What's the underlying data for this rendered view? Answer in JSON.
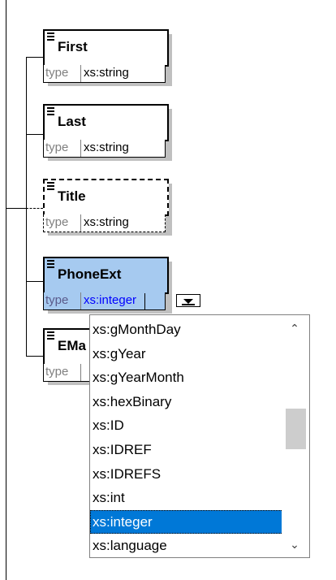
{
  "colors": {
    "selection_fill": "#a6caf0",
    "list_highlight": "#0078d7",
    "type_value_selected": "#0000ff",
    "shadow": "#c0c0c0"
  },
  "elements": [
    {
      "name": "First",
      "type_label": "type",
      "type_value": "xs:string",
      "optional": false,
      "selected": false
    },
    {
      "name": "Last",
      "type_label": "type",
      "type_value": "xs:string",
      "optional": false,
      "selected": false
    },
    {
      "name": "Title",
      "type_label": "type",
      "type_value": "xs:string",
      "optional": true,
      "selected": false
    },
    {
      "name": "PhoneExt",
      "type_label": "type",
      "type_value": "xs:integer",
      "optional": false,
      "selected": true
    },
    {
      "name": "EMa",
      "type_label": "type",
      "type_value": "",
      "optional": false,
      "selected": false
    }
  ],
  "icons": {
    "element_menu": "hamburger-icon",
    "dropdown_button": "dropdown-arrow-icon",
    "scroll_up": "chevron-up-icon",
    "scroll_down": "chevron-down-icon"
  },
  "type_dropdown": {
    "items": [
      "xs:gMonthDay",
      "xs:gYear",
      "xs:gYearMonth",
      "xs:hexBinary",
      "xs:ID",
      "xs:IDREF",
      "xs:IDREFS",
      "xs:int",
      "xs:integer",
      "xs:language"
    ],
    "selected": "xs:integer",
    "scroll_up_glyph": "⌃",
    "scroll_down_glyph": "⌄"
  }
}
